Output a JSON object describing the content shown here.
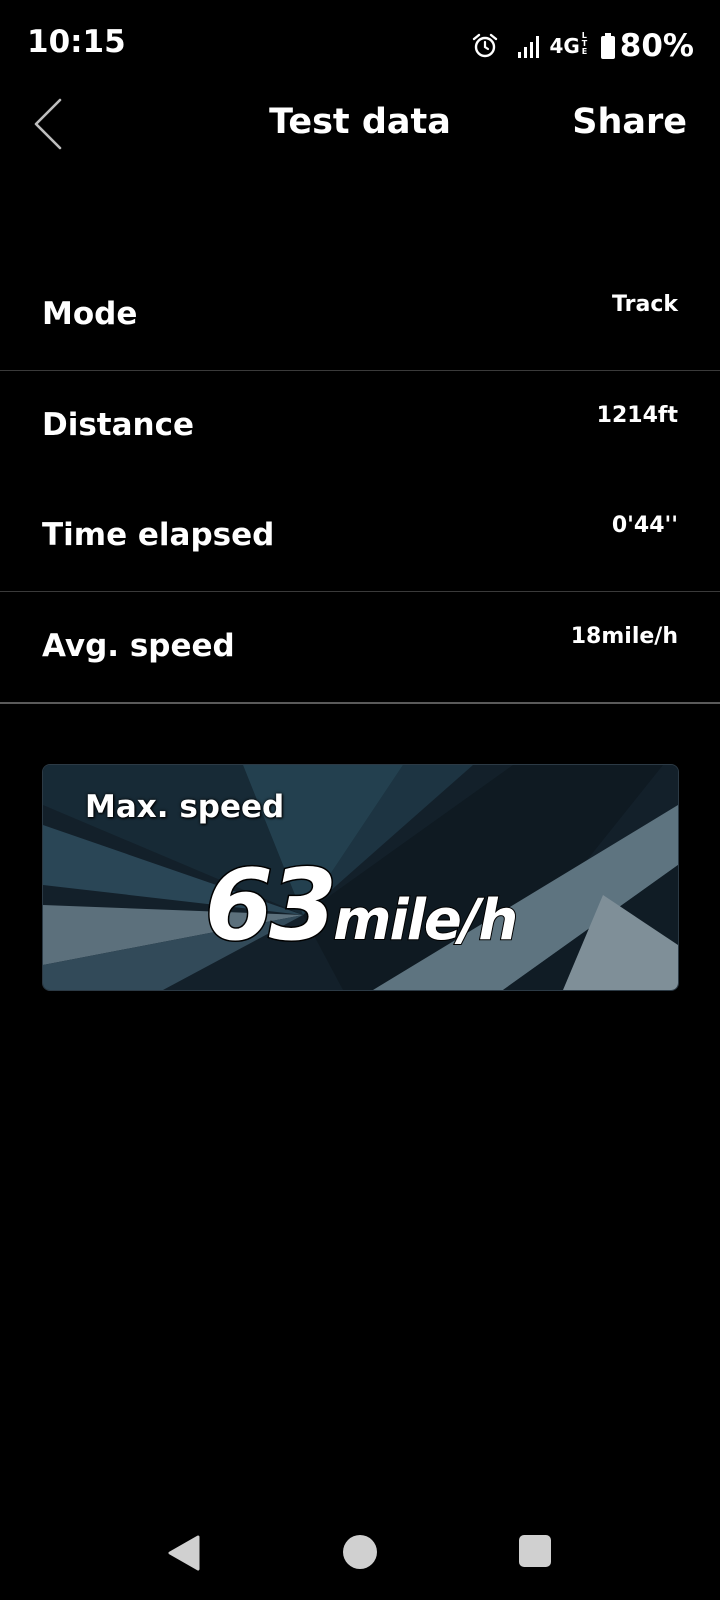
{
  "status_bar": {
    "time": "10:15",
    "network": "4G",
    "network_sub": "LTE",
    "battery": "80%",
    "icons": [
      "alarm-icon",
      "signal-icon",
      "battery-icon"
    ]
  },
  "header": {
    "title": "Test data",
    "share_label": "Share",
    "back_icon": "chevron-left-icon"
  },
  "rows": [
    {
      "label": "Mode",
      "value": "Track"
    },
    {
      "label": "Distance",
      "value": "1214ft"
    },
    {
      "label": "Time elapsed",
      "value": "0'44''"
    },
    {
      "label": "Avg. speed",
      "value": "18mile/h"
    }
  ],
  "max_speed": {
    "label": "Max. speed",
    "value": "63",
    "unit": "mile/h"
  },
  "nav": {
    "icons": [
      "nav-back-icon",
      "nav-home-icon",
      "nav-recent-icon"
    ]
  },
  "colors": {
    "background": "#000000",
    "text": "#ffffff",
    "card_bg": "#14212b",
    "nav_icon": "#d0d0d0"
  }
}
